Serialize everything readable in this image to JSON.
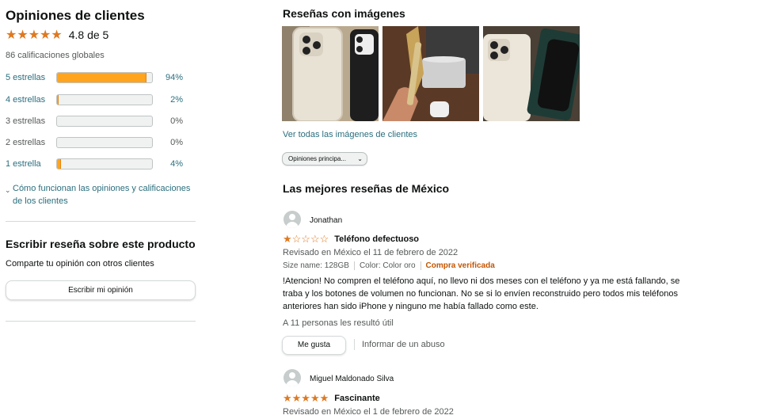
{
  "summary": {
    "title": "Opiniones de clientes",
    "rating_text": "4.8 de 5",
    "rating_value": 4.8,
    "total": "86 calificaciones globales",
    "histogram": [
      {
        "label": "5 estrellas",
        "pct": "94%",
        "fraction": 0.94
      },
      {
        "label": "4 estrellas",
        "pct": "2%",
        "fraction": 0.02
      },
      {
        "label": "3 estrellas",
        "pct": "0%",
        "fraction": 0.0
      },
      {
        "label": "2 estrellas",
        "pct": "0%",
        "fraction": 0.0
      },
      {
        "label": "1 estrella",
        "pct": "4%",
        "fraction": 0.04
      }
    ],
    "how_link_line1": "Cómo funcionan las opiniones y calificaciones",
    "how_link_line2": "de los clientes"
  },
  "write_review": {
    "title": "Escribir reseña sobre este producto",
    "subtitle": "Comparte tu opinión con otros clientes",
    "button": "Escribir mi opinión"
  },
  "images": {
    "title": "Reseñas con imágenes",
    "see_all": "Ver todas las imágenes de clientes"
  },
  "sort": {
    "selected": "Opiniones principa..."
  },
  "reviews_section": {
    "title": "Las mejores reseñas de México"
  },
  "reviews": [
    {
      "author": "Jonathan",
      "stars": 1,
      "title": "Teléfono defectuoso",
      "date": "Revisado en México el 11 de febrero de 2022",
      "size": "Size name: 128GB",
      "color": "Color: Color oro",
      "verified": "Compra verificada",
      "body_line1": "!Atencion! No compren el teléfono aquí, no llevo ni dos meses con el teléfono y ya me está fallando, se",
      "body_line2": "traba y los botones de volumen no funcionan. No se si lo envíen reconstruido pero todos mis teléfonos",
      "body_line3": "anteriores han sido iPhone y ninguno me había fallado como este.",
      "helpful": "A 11 personas les resultó útil",
      "like_button": "Me gusta",
      "report": "Informar de un abuso"
    },
    {
      "author": "Miguel Maldonado Silva",
      "stars": 5,
      "title": "Fascinante",
      "date": "Revisado en México el 1 de febrero de 2022"
    }
  ],
  "colors": {
    "star": "#de7921",
    "bar": "#ffa41c",
    "link": "#2a6e7d",
    "verified": "#c45500"
  }
}
